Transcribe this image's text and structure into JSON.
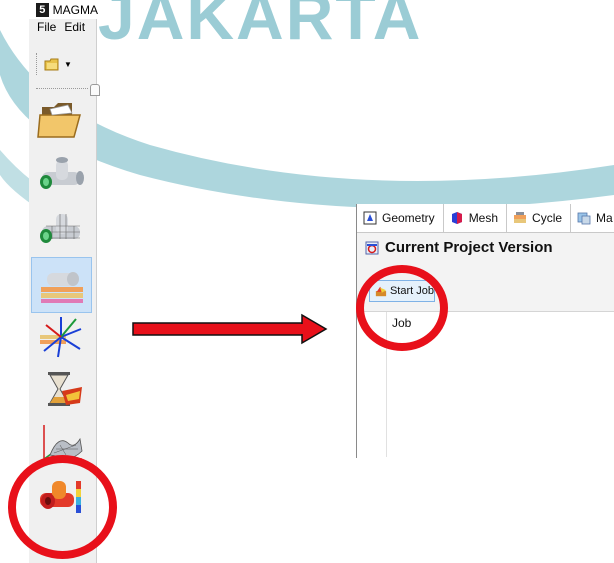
{
  "watermark": {
    "text": "JAKARTA"
  },
  "app": {
    "title": "MAGMA",
    "menu": [
      "File",
      "Edit"
    ]
  },
  "toolbar": {
    "icons": [
      "open-folder-icon",
      "dropdown-arrow-icon"
    ]
  },
  "tools": [
    {
      "name": "open-project-tool",
      "icon": "folder-icon"
    },
    {
      "name": "geometry-tool",
      "icon": "pipe-tee-icon"
    },
    {
      "name": "mesh-tool",
      "icon": "meshed-pipe-tee-icon"
    },
    {
      "name": "process-tool",
      "icon": "layered-process-icon"
    },
    {
      "name": "definitions-tool",
      "icon": "axes-definitions-icon"
    },
    {
      "name": "simulation-tool",
      "icon": "hourglass-simulation-icon"
    },
    {
      "name": "results-tool",
      "icon": "surface-plot-icon"
    },
    {
      "name": "results-view-tool",
      "icon": "colored-result-tee-icon"
    }
  ],
  "window": {
    "tabs": [
      {
        "label": "Geometry",
        "icon": "geometry-tab-icon"
      },
      {
        "label": "Mesh",
        "icon": "mesh-tab-icon"
      },
      {
        "label": "Cycle",
        "icon": "cycle-tab-icon"
      },
      {
        "label": "Ma",
        "icon": "material-tab-icon"
      }
    ],
    "project_title": "Current Project Version",
    "start_job_label": "Start Job",
    "columns": [
      "Job"
    ]
  },
  "colors": {
    "highlight": "#e8101a",
    "watermark": "#4aa4b3",
    "active_tool": "#cce2f8"
  }
}
